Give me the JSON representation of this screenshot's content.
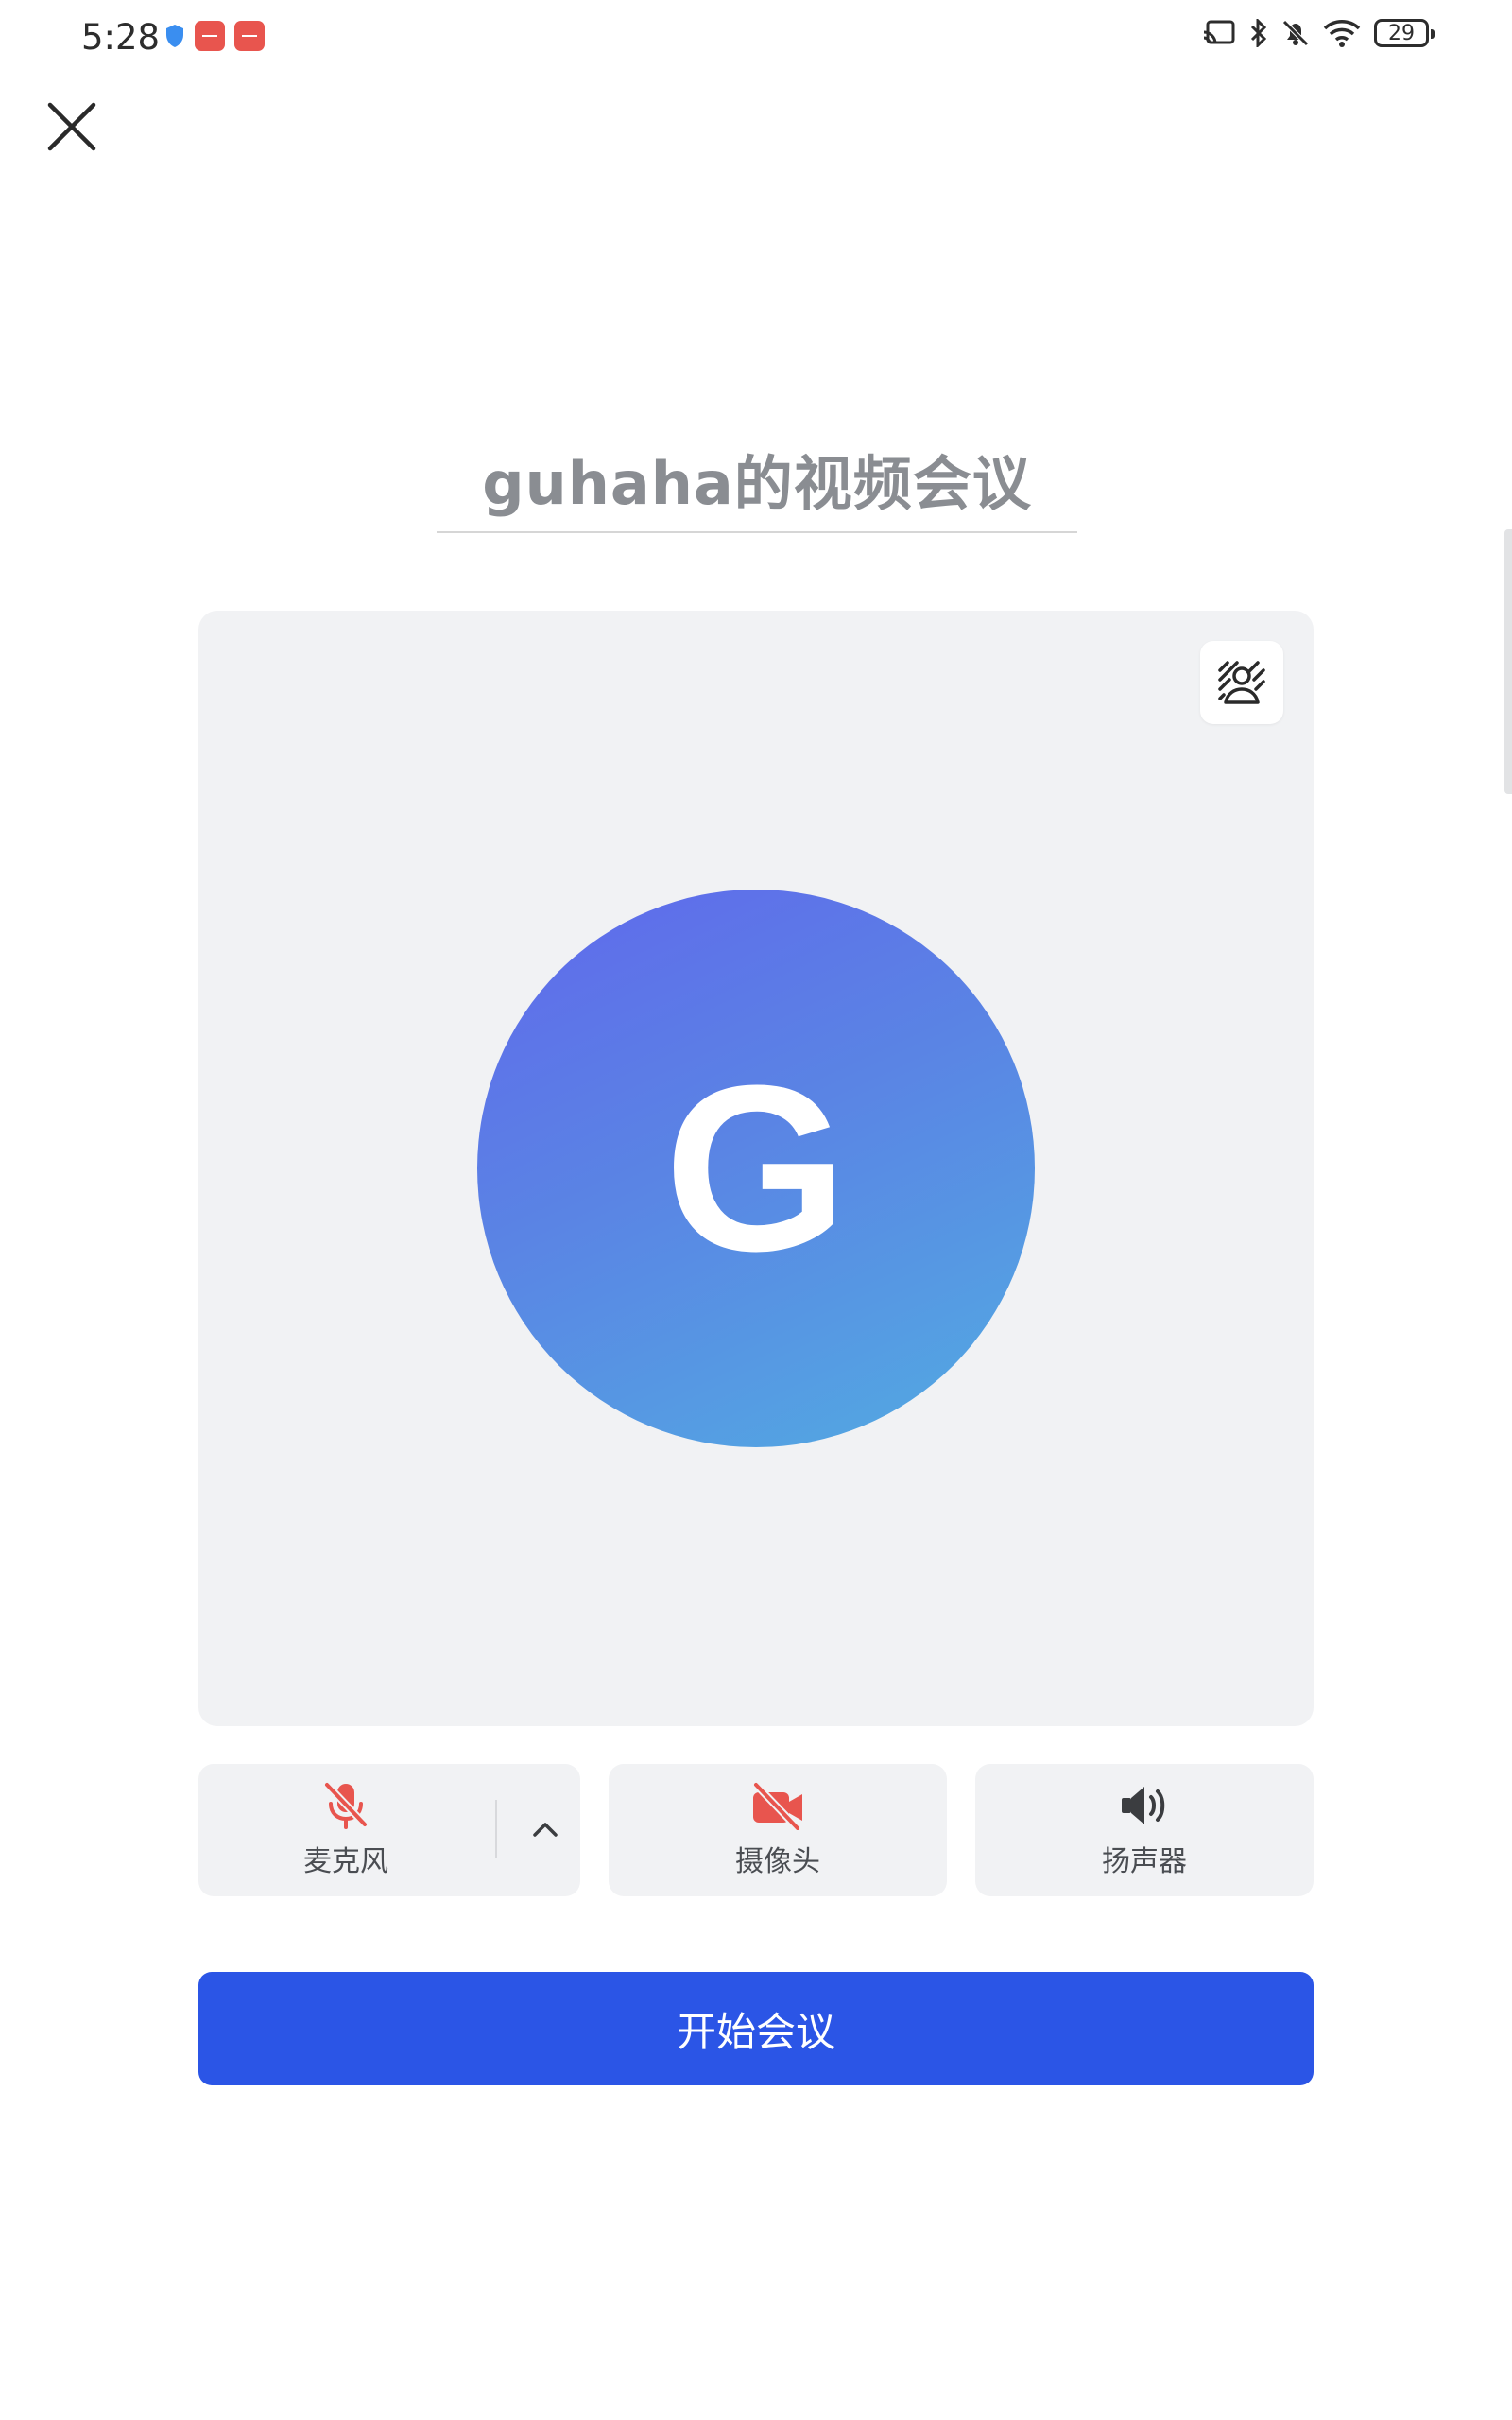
{
  "status_bar": {
    "time": "5:28",
    "battery": "29",
    "icons": [
      "security-shield-icon",
      "huawei-app-icon",
      "huawei-app-icon",
      "screen-cast-icon",
      "bluetooth-icon",
      "mute-bell-icon",
      "wifi-icon",
      "battery-icon"
    ]
  },
  "header": {
    "close_icon": "close-icon"
  },
  "meeting": {
    "title": "guhaha的视频会议"
  },
  "preview": {
    "background_button_icon": "virtual-background-icon",
    "avatar_letter": "G",
    "avatar_gradient": [
      "#6068ec",
      "#52ace2"
    ]
  },
  "controls": {
    "microphone": {
      "label": "麦克风",
      "icon": "mic-off-icon",
      "icon_color": "#e8554e"
    },
    "camera": {
      "label": "摄像头",
      "icon": "camera-off-icon",
      "icon_color": "#e8554e"
    },
    "speaker": {
      "label": "扬声器",
      "icon": "speaker-icon",
      "icon_color": "#3b3d40"
    }
  },
  "start_button": {
    "label": "开始会议",
    "color": "#2b55e6"
  }
}
